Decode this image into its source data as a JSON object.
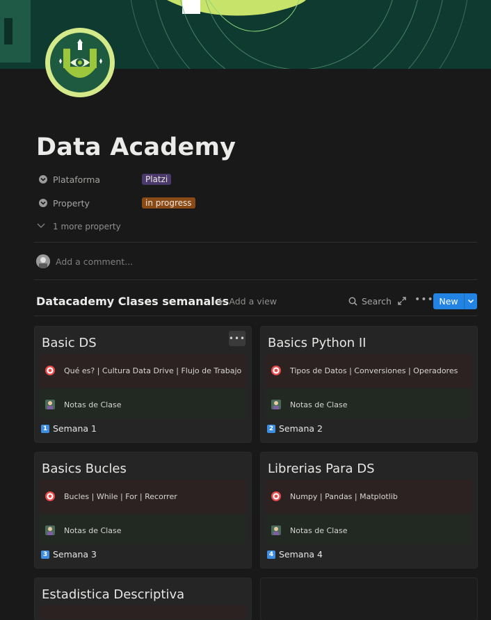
{
  "page": {
    "title": "Data Academy"
  },
  "properties": [
    {
      "name": "Plataforma",
      "value": "Platzi",
      "color": "#4a3a6b"
    },
    {
      "name": "Property",
      "value": "in progress",
      "color": "#8a4a16"
    }
  ],
  "more_property": "1 more property",
  "comment_placeholder": "Add a comment...",
  "database": {
    "title": "Datacademy Clases semanales",
    "add_view": "Add a view",
    "search": "Search",
    "new_button": "New",
    "cards": [
      {
        "title": "Basic DS",
        "topic_icon": "target-icon",
        "topic": "Qué es? | Cultura Data Drive | Flujo de Trabajo",
        "notes_icon": "person-icon",
        "notes": "Notas de Clase",
        "week_num": "1",
        "week": "Semana 1"
      },
      {
        "title": "Basics Python II",
        "topic_icon": "target-icon",
        "topic": "Tipos de Datos | Conversiones | Operadores",
        "notes_icon": "person-icon",
        "notes": "Notas de Clase",
        "week_num": "2",
        "week": "Semana 2"
      },
      {
        "title": "Basics Bucles",
        "topic_icon": "target-icon",
        "topic": "Bucles | While | For | Recorrer",
        "notes_icon": "person-icon",
        "notes": "Notas de Clase",
        "week_num": "3",
        "week": "Semana 3"
      },
      {
        "title": "Librerias Para DS",
        "topic_icon": "target-icon",
        "topic": "Numpy | Pandas | Matplotlib",
        "notes_icon": "person-icon",
        "notes": "Notas de Clase",
        "week_num": "4",
        "week": "Semana 4"
      },
      {
        "title": "Estadistica Descriptiva"
      },
      {
        "title": ""
      }
    ]
  },
  "colors": {
    "background": "#191919",
    "cover": "#0f3a30",
    "accent": "#2383e2",
    "logo_green": "#9cc63b"
  }
}
